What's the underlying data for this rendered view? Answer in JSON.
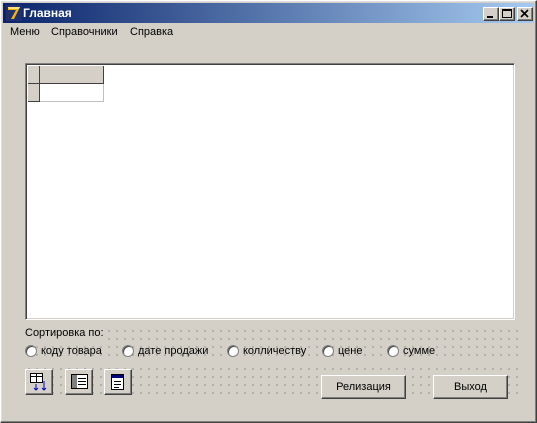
{
  "window": {
    "title": "Главная"
  },
  "menu": {
    "items": [
      "Меню",
      "Справочники",
      "Справка"
    ]
  },
  "sort": {
    "label": "Сортировка по:",
    "options": [
      "коду товара",
      "дате продажи",
      "колличеству",
      "цене",
      "сумме"
    ]
  },
  "icons": [
    "table-sort-icon",
    "table-view-icon",
    "report-icon"
  ],
  "buttons": {
    "realization": "Релизация",
    "exit": "Выход"
  },
  "colors": {
    "face": "#d4d0c8",
    "title_start": "#0a246a",
    "title_end": "#a6caf0"
  }
}
